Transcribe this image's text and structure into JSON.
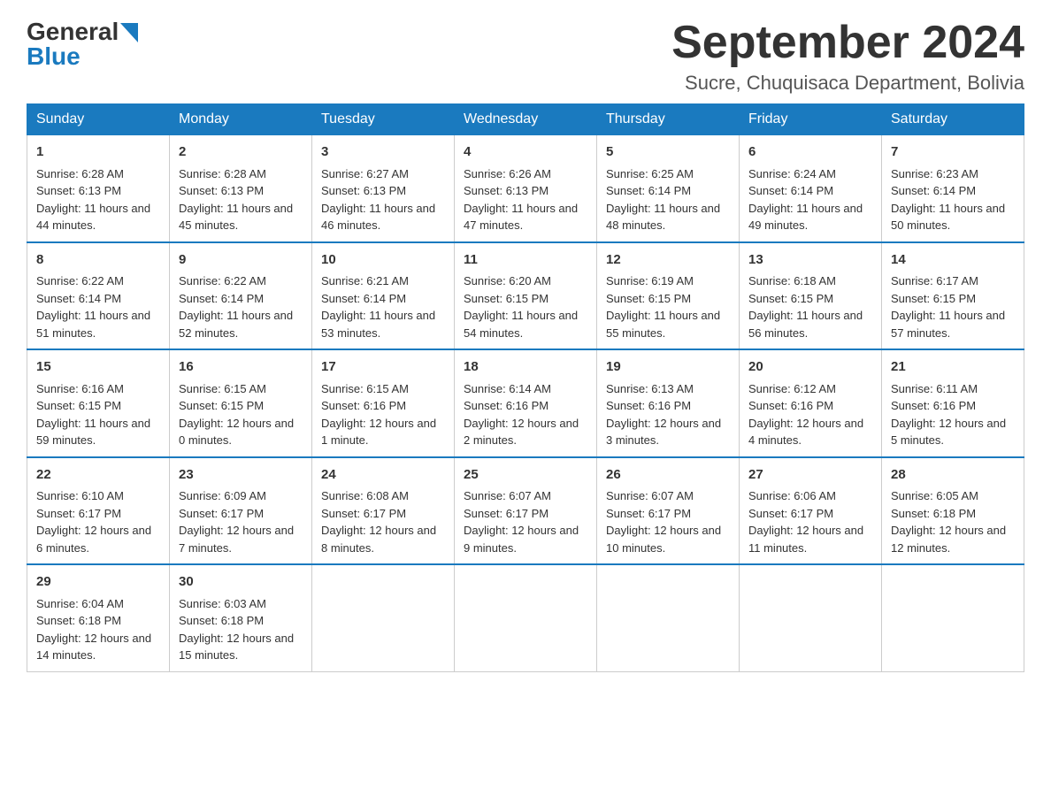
{
  "logo": {
    "general": "General",
    "blue": "Blue"
  },
  "title": {
    "month_year": "September 2024",
    "location": "Sucre, Chuquisaca Department, Bolivia"
  },
  "days_of_week": [
    "Sunday",
    "Monday",
    "Tuesday",
    "Wednesday",
    "Thursday",
    "Friday",
    "Saturday"
  ],
  "weeks": [
    [
      {
        "day": "1",
        "sunrise": "6:28 AM",
        "sunset": "6:13 PM",
        "daylight": "11 hours and 44 minutes."
      },
      {
        "day": "2",
        "sunrise": "6:28 AM",
        "sunset": "6:13 PM",
        "daylight": "11 hours and 45 minutes."
      },
      {
        "day": "3",
        "sunrise": "6:27 AM",
        "sunset": "6:13 PM",
        "daylight": "11 hours and 46 minutes."
      },
      {
        "day": "4",
        "sunrise": "6:26 AM",
        "sunset": "6:13 PM",
        "daylight": "11 hours and 47 minutes."
      },
      {
        "day": "5",
        "sunrise": "6:25 AM",
        "sunset": "6:14 PM",
        "daylight": "11 hours and 48 minutes."
      },
      {
        "day": "6",
        "sunrise": "6:24 AM",
        "sunset": "6:14 PM",
        "daylight": "11 hours and 49 minutes."
      },
      {
        "day": "7",
        "sunrise": "6:23 AM",
        "sunset": "6:14 PM",
        "daylight": "11 hours and 50 minutes."
      }
    ],
    [
      {
        "day": "8",
        "sunrise": "6:22 AM",
        "sunset": "6:14 PM",
        "daylight": "11 hours and 51 minutes."
      },
      {
        "day": "9",
        "sunrise": "6:22 AM",
        "sunset": "6:14 PM",
        "daylight": "11 hours and 52 minutes."
      },
      {
        "day": "10",
        "sunrise": "6:21 AM",
        "sunset": "6:14 PM",
        "daylight": "11 hours and 53 minutes."
      },
      {
        "day": "11",
        "sunrise": "6:20 AM",
        "sunset": "6:15 PM",
        "daylight": "11 hours and 54 minutes."
      },
      {
        "day": "12",
        "sunrise": "6:19 AM",
        "sunset": "6:15 PM",
        "daylight": "11 hours and 55 minutes."
      },
      {
        "day": "13",
        "sunrise": "6:18 AM",
        "sunset": "6:15 PM",
        "daylight": "11 hours and 56 minutes."
      },
      {
        "day": "14",
        "sunrise": "6:17 AM",
        "sunset": "6:15 PM",
        "daylight": "11 hours and 57 minutes."
      }
    ],
    [
      {
        "day": "15",
        "sunrise": "6:16 AM",
        "sunset": "6:15 PM",
        "daylight": "11 hours and 59 minutes."
      },
      {
        "day": "16",
        "sunrise": "6:15 AM",
        "sunset": "6:15 PM",
        "daylight": "12 hours and 0 minutes."
      },
      {
        "day": "17",
        "sunrise": "6:15 AM",
        "sunset": "6:16 PM",
        "daylight": "12 hours and 1 minute."
      },
      {
        "day": "18",
        "sunrise": "6:14 AM",
        "sunset": "6:16 PM",
        "daylight": "12 hours and 2 minutes."
      },
      {
        "day": "19",
        "sunrise": "6:13 AM",
        "sunset": "6:16 PM",
        "daylight": "12 hours and 3 minutes."
      },
      {
        "day": "20",
        "sunrise": "6:12 AM",
        "sunset": "6:16 PM",
        "daylight": "12 hours and 4 minutes."
      },
      {
        "day": "21",
        "sunrise": "6:11 AM",
        "sunset": "6:16 PM",
        "daylight": "12 hours and 5 minutes."
      }
    ],
    [
      {
        "day": "22",
        "sunrise": "6:10 AM",
        "sunset": "6:17 PM",
        "daylight": "12 hours and 6 minutes."
      },
      {
        "day": "23",
        "sunrise": "6:09 AM",
        "sunset": "6:17 PM",
        "daylight": "12 hours and 7 minutes."
      },
      {
        "day": "24",
        "sunrise": "6:08 AM",
        "sunset": "6:17 PM",
        "daylight": "12 hours and 8 minutes."
      },
      {
        "day": "25",
        "sunrise": "6:07 AM",
        "sunset": "6:17 PM",
        "daylight": "12 hours and 9 minutes."
      },
      {
        "day": "26",
        "sunrise": "6:07 AM",
        "sunset": "6:17 PM",
        "daylight": "12 hours and 10 minutes."
      },
      {
        "day": "27",
        "sunrise": "6:06 AM",
        "sunset": "6:17 PM",
        "daylight": "12 hours and 11 minutes."
      },
      {
        "day": "28",
        "sunrise": "6:05 AM",
        "sunset": "6:18 PM",
        "daylight": "12 hours and 12 minutes."
      }
    ],
    [
      {
        "day": "29",
        "sunrise": "6:04 AM",
        "sunset": "6:18 PM",
        "daylight": "12 hours and 14 minutes."
      },
      {
        "day": "30",
        "sunrise": "6:03 AM",
        "sunset": "6:18 PM",
        "daylight": "12 hours and 15 minutes."
      },
      null,
      null,
      null,
      null,
      null
    ]
  ]
}
